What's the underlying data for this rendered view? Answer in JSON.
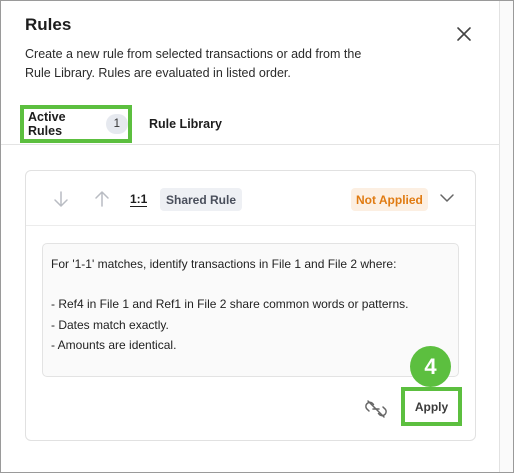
{
  "dialog": {
    "title": "Rules",
    "description": "Create a new rule from selected transactions or add from the Rule Library. Rules are evaluated in listed order.",
    "close_icon": "close-icon"
  },
  "tabs": {
    "active": {
      "label": "Active Rules",
      "count": "1"
    },
    "library": {
      "label": "Rule Library"
    }
  },
  "rule_card": {
    "move_down_icon": "arrow-down-icon",
    "move_up_icon": "arrow-up-icon",
    "ratio": "1:1",
    "type_badge": "Shared Rule",
    "status": "Not Applied",
    "expand_icon": "chevron-down-icon",
    "rule_lines": [
      "For '1-1' matches, identify transactions in File 1 and File 2 where:",
      "",
      "- Ref4 in File 1 and Ref1 in File 2 share common words or patterns.",
      "- Dates match exactly.",
      "- Amounts are identical."
    ],
    "unlink_icon": "unlink-icon",
    "apply_label": "Apply"
  },
  "annotation": {
    "step": "4"
  },
  "colors": {
    "highlight": "#5cbf3f",
    "status_text": "#e07b12",
    "status_bg": "#fcefe2",
    "badge_bg": "#eef0f4"
  }
}
